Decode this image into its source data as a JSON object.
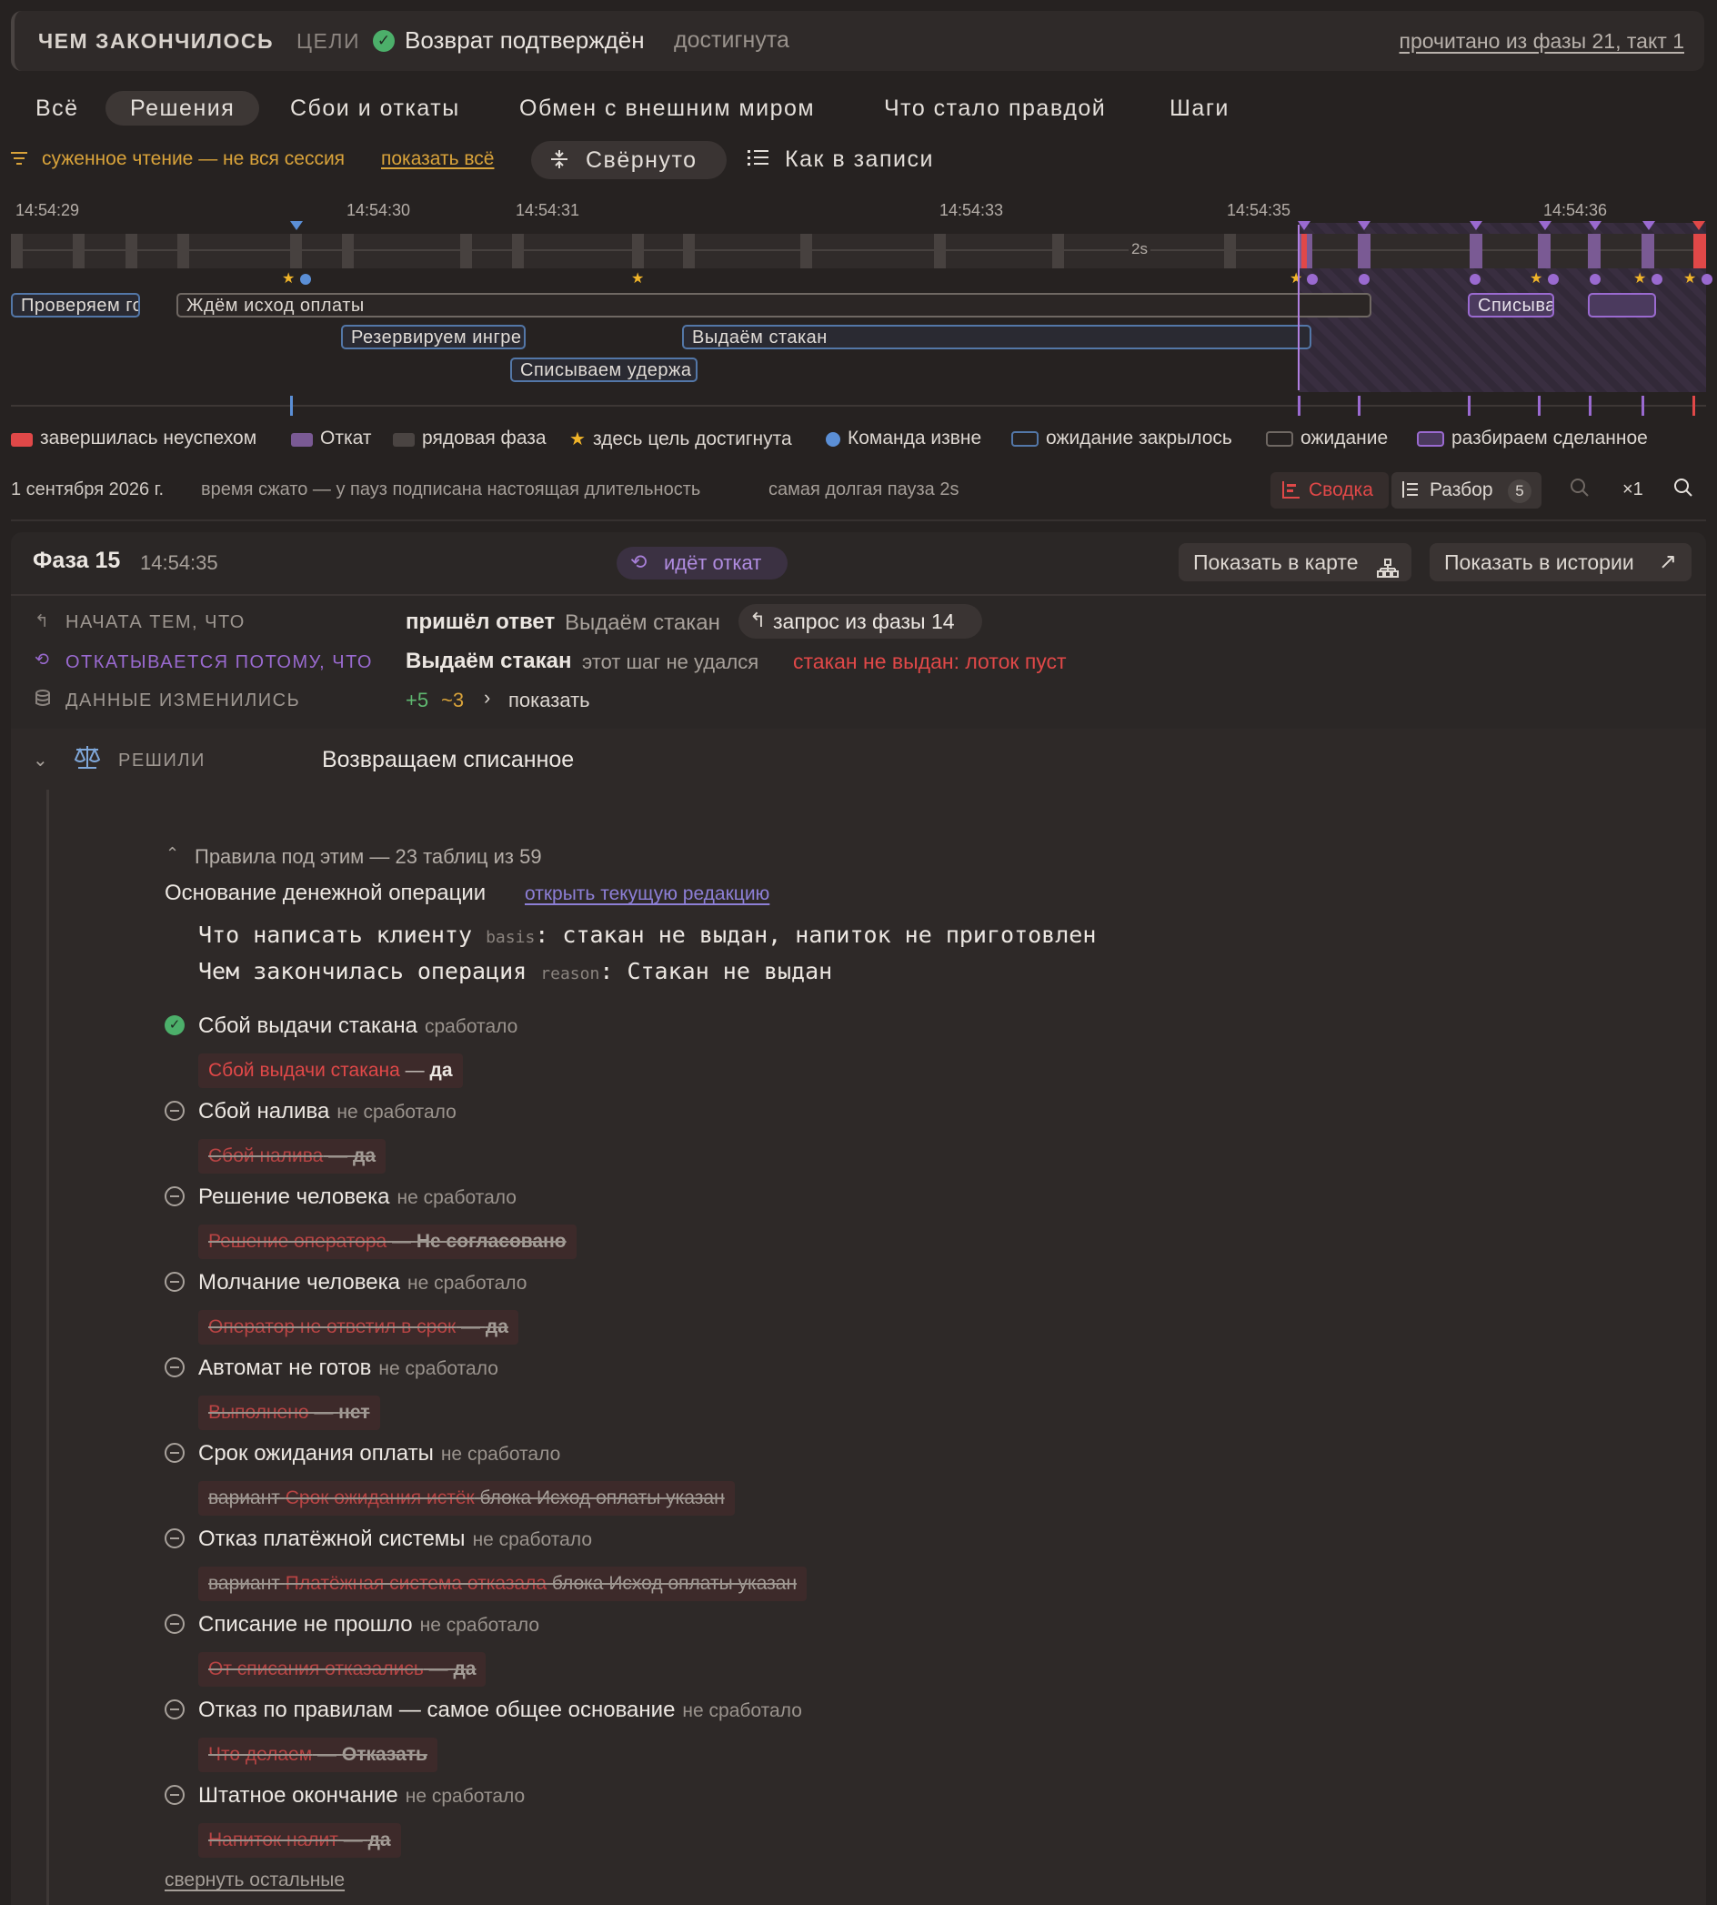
{
  "banner": {
    "label": "ЧЕМ ЗАКОНЧИЛОСЬ",
    "goals_label": "ЦЕЛИ",
    "goal_name": "Возврат подтверждён",
    "goal_status": "достигнута",
    "read_from": "прочитано из фазы 21, такт 1"
  },
  "tabs": [
    "Всё",
    "Решения",
    "Сбои и откаты",
    "Обмен с внешним миром",
    "Что стало правдой",
    "Шаги"
  ],
  "active_tab": "Решения",
  "filter": {
    "narrow_text": "суженное чтение — не вся сессия",
    "show_all": "показать всё",
    "collapsed_label": "Свёрнуто",
    "as_recorded_label": "Как в записи"
  },
  "timeline": {
    "ticks": [
      "14:54:29",
      "14:54:30",
      "14:54:31",
      "14:54:33",
      "14:54:35",
      "14:54:36"
    ],
    "gap_label": "2s",
    "bars": [
      {
        "label": "Проверяем го",
        "kind": "closed"
      },
      {
        "label": "Ждём исход оплаты",
        "kind": "wait"
      },
      {
        "label": "Резервируем ингре",
        "kind": "closed"
      },
      {
        "label": "Выдаём стакан",
        "kind": "closed"
      },
      {
        "label": "Списываем удержа",
        "kind": "closed"
      },
      {
        "label": "Списыва",
        "kind": "sorting"
      },
      {
        "label": "",
        "kind": "sorting"
      }
    ]
  },
  "legend": [
    {
      "label": "завершилась неуспехом",
      "color": "#e04848"
    },
    {
      "label": "Откат",
      "color": "#7a5a94"
    },
    {
      "label": "рядовая фаза",
      "color": "#4a4442"
    },
    {
      "label": "здесь цель достигнута",
      "color": "#f0b429"
    },
    {
      "label": "Команда извне",
      "color": "#5b8fd6"
    },
    {
      "label": "ожидание закрылось",
      "color": "#5377a8"
    },
    {
      "label": "ожидание",
      "color": "#6f6863"
    },
    {
      "label": "разбираем сделанное",
      "color": "#9a6ad0"
    }
  ],
  "info": {
    "date": "1 сентября 2026 г.",
    "compressed": "время сжато — у пауз подписана настоящая длительность",
    "longest_pause": "самая долгая пауза 2s",
    "summary_btn": "Сводка",
    "breakdown_btn": "Разбор",
    "breakdown_count": "5",
    "zoom": "×1"
  },
  "phase": {
    "title": "Фаза 15",
    "time": "14:54:35",
    "status": "идёт откат",
    "show_on_map": "Показать в карте",
    "show_in_history": "Показать в истории",
    "started_label": "НАЧАТА ТЕМ, ЧТО",
    "started_event": "пришёл ответ",
    "started_step": "Выдаём стакан",
    "started_request": "запрос из фазы 14",
    "rollback_label": "ОТКАТЫВАЕТСЯ ПОТОМУ, ЧТО",
    "rollback_step": "Выдаём стакан",
    "rollback_reason": "этот шаг не удался",
    "rollback_error": "стакан не выдан: лоток пуст",
    "data_label": "ДАННЫЕ ИЗМЕНИЛИСЬ",
    "data_added": "+5",
    "data_changed": "~3",
    "data_show": "показать"
  },
  "decision": {
    "label": "РЕШИЛИ",
    "value": "Возвращаем списанное",
    "rules_header": "Правила под этим — 23 таблиц из 59",
    "basis_title": "Основание денежной операции",
    "basis_link": "открыть текущую редакцию",
    "fields": [
      {
        "name": "Что написать клиенту",
        "key": "basis",
        "value": "стакан не выдан, напиток не приготовлен"
      },
      {
        "name": "Чем закончилась операция",
        "key": "reason",
        "value": "Стакан не выдан"
      }
    ],
    "rules": [
      {
        "name": "Сбой выдачи стакана",
        "status": "сработало",
        "fired": true,
        "prefix": "",
        "cond": "Сбой выдачи стакана",
        "mid": " — ",
        "val": "да",
        "suffix": ""
      },
      {
        "name": "Сбой налива",
        "status": "не сработало",
        "fired": false,
        "prefix": "",
        "cond": "Сбой налива",
        "mid": " — ",
        "val": "да",
        "suffix": ""
      },
      {
        "name": "Решение человека",
        "status": "не сработало",
        "fired": false,
        "prefix": "",
        "cond": "Решение оператора",
        "mid": " — ",
        "val": "Не согласовано",
        "suffix": ""
      },
      {
        "name": "Молчание человека",
        "status": "не сработало",
        "fired": false,
        "prefix": "",
        "cond": "Оператор не ответил в срок",
        "mid": " — ",
        "val": "да",
        "suffix": ""
      },
      {
        "name": "Автомат не готов",
        "status": "не сработало",
        "fired": false,
        "prefix": "",
        "cond": "Выполнено",
        "mid": " — ",
        "val": "нет",
        "suffix": ""
      },
      {
        "name": "Срок ожидания оплаты",
        "status": "не сработало",
        "fired": false,
        "prefix": "вариант ",
        "cond": "Срок ожидания истёк",
        "mid": "",
        "val": "",
        "suffix": " блока Исход оплаты указан"
      },
      {
        "name": "Отказ платёжной системы",
        "status": "не сработало",
        "fired": false,
        "prefix": "вариант ",
        "cond": "Платёжная система отказала",
        "mid": "",
        "val": "",
        "suffix": " блока Исход оплаты указан"
      },
      {
        "name": "Списание не прошло",
        "status": "не сработало",
        "fired": false,
        "prefix": "",
        "cond": "От списания отказались",
        "mid": " — ",
        "val": "да",
        "suffix": ""
      },
      {
        "name": "Отказ по правилам — самое общее основание",
        "status": "не сработало",
        "fired": false,
        "prefix": "",
        "cond": "Что делаем",
        "mid": " — ",
        "val": "Отказать",
        "suffix": ""
      },
      {
        "name": "Штатное окончание",
        "status": "не сработало",
        "fired": false,
        "prefix": "",
        "cond": "Напиток налит",
        "mid": " — ",
        "val": "да",
        "suffix": ""
      }
    ],
    "collapse_rest": "свернуть остальные"
  }
}
